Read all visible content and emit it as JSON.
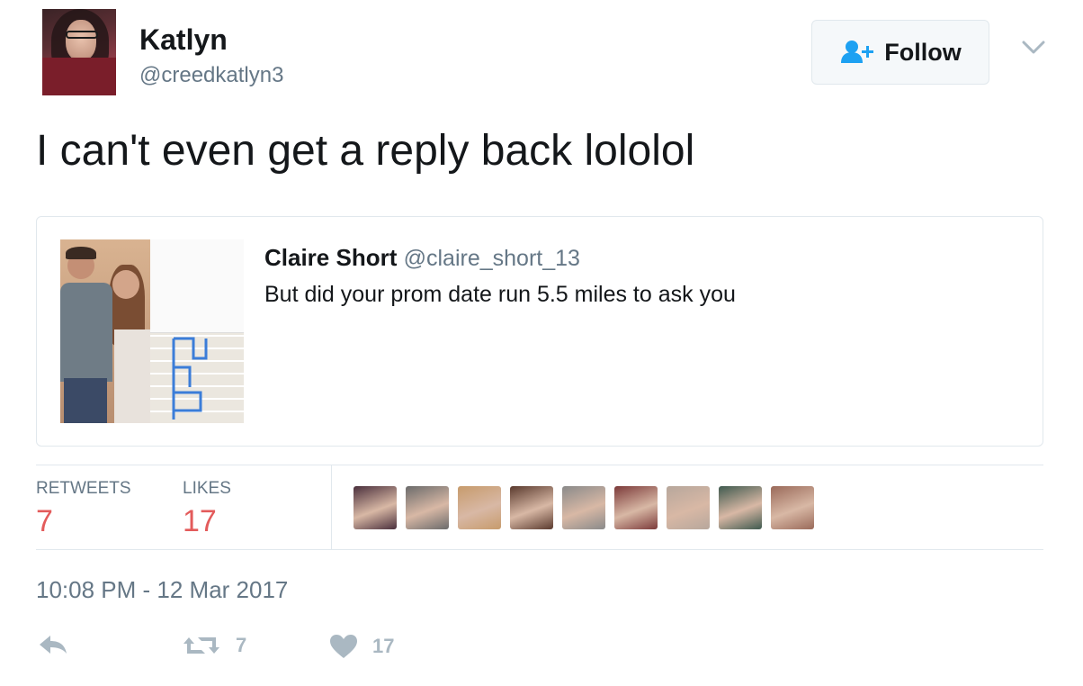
{
  "user": {
    "name": "Katlyn",
    "handle": "@creedkatlyn3"
  },
  "follow_button": {
    "label": "Follow",
    "icon": "add-user-icon"
  },
  "tweet": {
    "text": "I can't even get a reply back lololol",
    "timestamp": "10:08 PM - 12 Mar 2017"
  },
  "quoted_tweet": {
    "author": "Claire Short",
    "handle": "@claire_short_13",
    "text": "But did your prom date run 5.5 miles to ask you"
  },
  "stats": {
    "retweets_label": "RETWEETS",
    "retweets_count": "7",
    "likes_label": "LIKES",
    "likes_count": "17"
  },
  "likers": [
    {
      "color": "#4a2f3c"
    },
    {
      "color": "#6b6b6b"
    },
    {
      "color": "#c79b6c"
    },
    {
      "color": "#5a3a2e"
    },
    {
      "color": "#8a8a8a"
    },
    {
      "color": "#7c3a3a"
    },
    {
      "color": "#b7a79c"
    },
    {
      "color": "#3f5a4f"
    },
    {
      "color": "#9a6a5a"
    }
  ],
  "actions": {
    "reply_icon": "reply-icon",
    "retweet_icon": "retweet-icon",
    "retweet_count": "7",
    "like_icon": "heart-icon",
    "like_count": "17"
  },
  "colors": {
    "count_accent": "#e35b5b",
    "secondary_text": "#657786",
    "action_gray": "#aab8c2",
    "follow_icon_blue": "#1da1f2"
  }
}
